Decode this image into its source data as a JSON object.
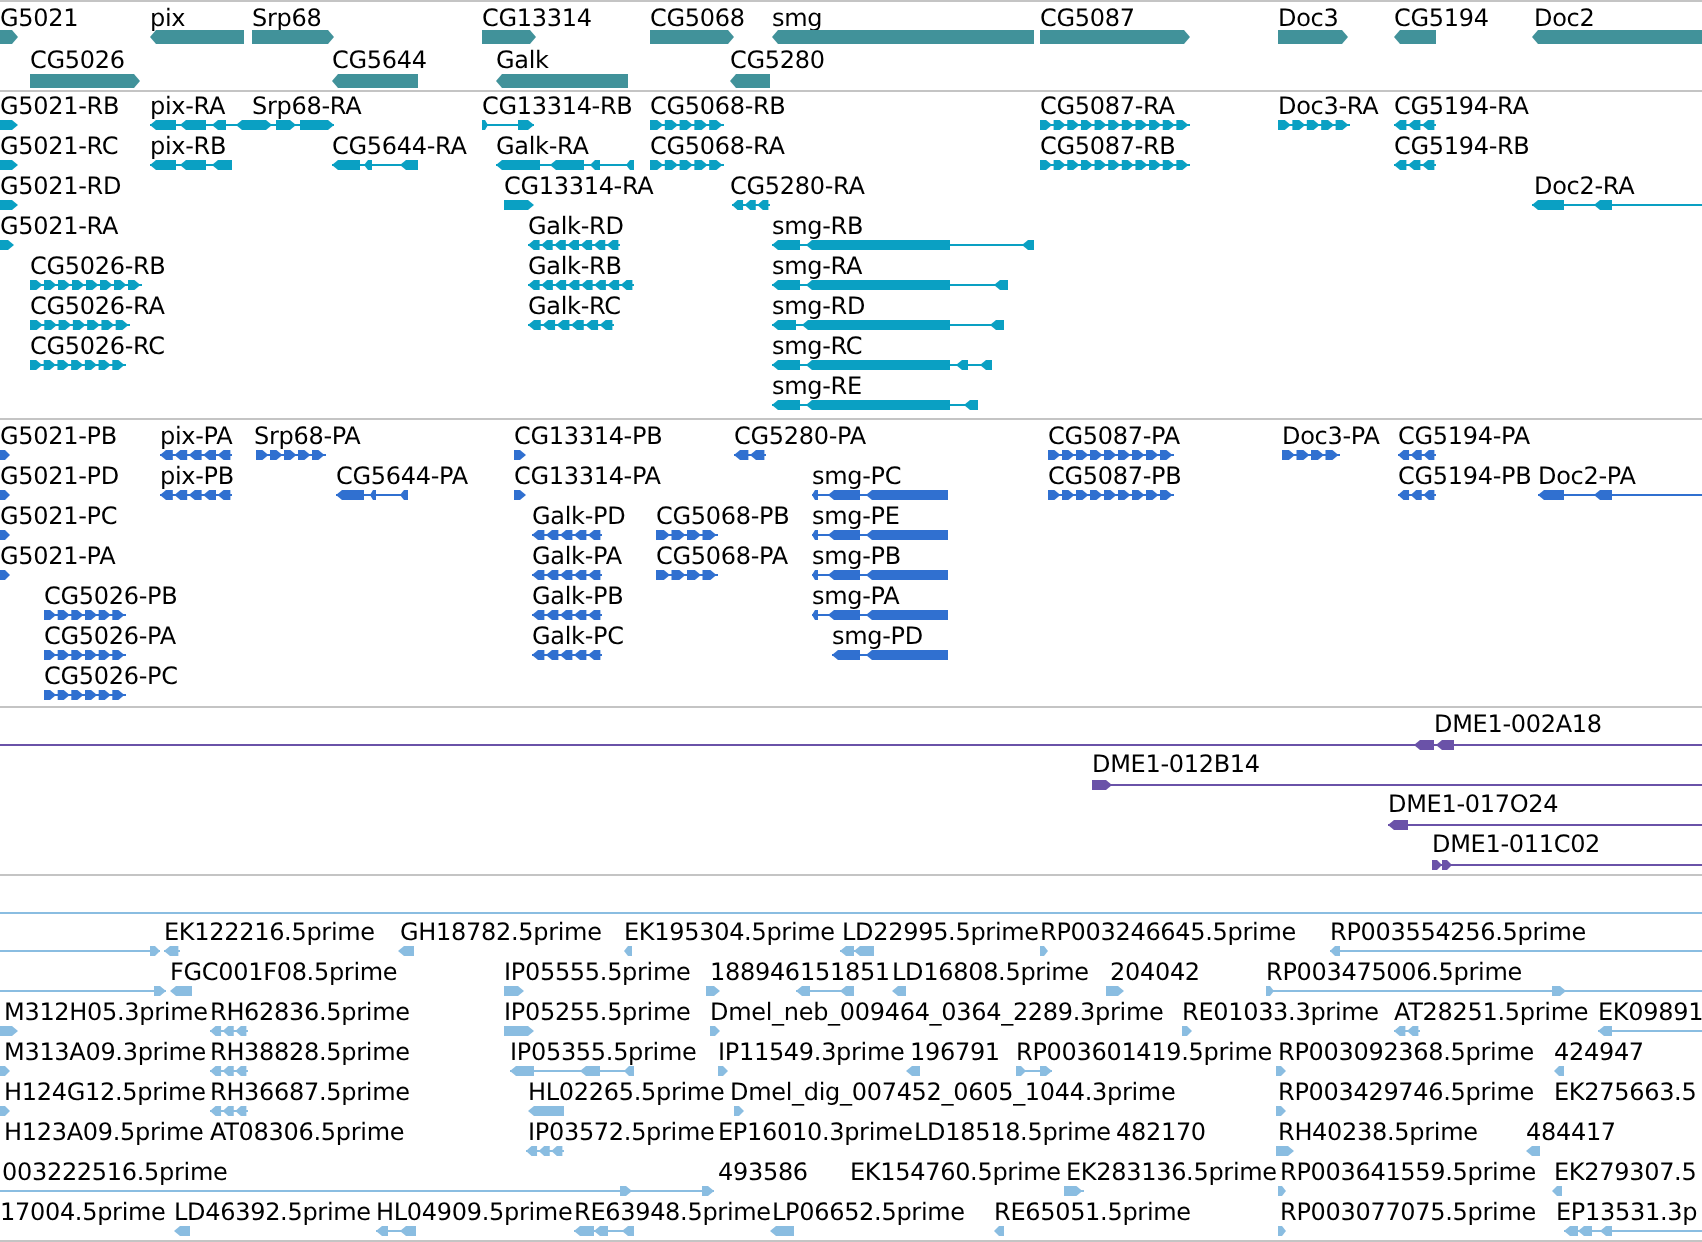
{
  "tracks": [
    {
      "kind": "genes",
      "color": "#41929a",
      "lanes": [
        {
          "features": [
            {
              "label": "G5021",
              "reverse": false
            },
            {
              "label": "pix",
              "reverse": true
            },
            {
              "label": "Srp68",
              "reverse": false
            },
            {
              "label": "CG13314",
              "reverse": false
            },
            {
              "label": "CG5068",
              "reverse": false
            },
            {
              "label": "smg",
              "reverse": true
            },
            {
              "label": "CG5087",
              "reverse": false
            },
            {
              "label": "Doc3",
              "reverse": false
            },
            {
              "label": "CG5194",
              "reverse": true
            },
            {
              "label": "Doc2",
              "reverse": true
            }
          ]
        },
        {
          "features": [
            {
              "label": "CG5026",
              "reverse": false
            },
            {
              "label": "CG5644",
              "reverse": true
            },
            {
              "label": "Galk",
              "reverse": true
            },
            {
              "label": "CG5280",
              "reverse": true
            }
          ]
        }
      ]
    },
    {
      "kind": "transcripts",
      "color": "#0aa0c3",
      "lanes": [
        {
          "features": [
            {
              "label": "G5021-RB",
              "reverse": false
            },
            {
              "label": "pix-RA",
              "reverse": true
            },
            {
              "label": "Srp68-RA",
              "reverse": false
            },
            {
              "label": "CG13314-RB",
              "reverse": false
            },
            {
              "label": "CG5068-RB",
              "reverse": false
            },
            {
              "label": "CG5087-RA",
              "reverse": false
            },
            {
              "label": "Doc3-RA",
              "reverse": false
            },
            {
              "label": "CG5194-RA",
              "reverse": true
            }
          ]
        },
        {
          "features": [
            {
              "label": "G5021-RC",
              "reverse": false
            },
            {
              "label": "pix-RB",
              "reverse": true
            },
            {
              "label": "CG5644-RA",
              "reverse": true
            },
            {
              "label": "Galk-RA",
              "reverse": true
            },
            {
              "label": "CG5068-RA",
              "reverse": false
            },
            {
              "label": "CG5087-RB",
              "reverse": false
            },
            {
              "label": "CG5194-RB",
              "reverse": true
            }
          ]
        },
        {
          "features": [
            {
              "label": "G5021-RD",
              "reverse": false
            },
            {
              "label": "CG13314-RA",
              "reverse": false
            },
            {
              "label": "CG5280-RA",
              "reverse": true
            },
            {
              "label": "Doc2-RA",
              "reverse": true
            }
          ]
        },
        {
          "features": [
            {
              "label": "G5021-RA",
              "reverse": false
            },
            {
              "label": "Galk-RD",
              "reverse": true
            },
            {
              "label": "smg-RB",
              "reverse": true
            }
          ]
        },
        {
          "features": [
            {
              "label": "CG5026-RB",
              "reverse": false
            },
            {
              "label": "Galk-RB",
              "reverse": true
            },
            {
              "label": "smg-RA",
              "reverse": true
            }
          ]
        },
        {
          "features": [
            {
              "label": "CG5026-RA",
              "reverse": false
            },
            {
              "label": "Galk-RC",
              "reverse": true
            },
            {
              "label": "smg-RD",
              "reverse": true
            }
          ]
        },
        {
          "features": [
            {
              "label": "CG5026-RC",
              "reverse": false
            },
            {
              "label": "smg-RC",
              "reverse": true
            }
          ]
        },
        {
          "features": [
            {
              "label": "smg-RE",
              "reverse": true
            }
          ]
        }
      ]
    },
    {
      "kind": "proteins",
      "color": "#3070d0",
      "lanes": [
        {
          "features": [
            {
              "label": "G5021-PB",
              "reverse": false
            },
            {
              "label": "pix-PA",
              "reverse": true
            },
            {
              "label": "Srp68-PA",
              "reverse": false
            },
            {
              "label": "CG13314-PB",
              "reverse": false
            },
            {
              "label": "CG5280-PA",
              "reverse": true
            },
            {
              "label": "CG5087-PA",
              "reverse": false
            },
            {
              "label": "Doc3-PA",
              "reverse": false
            },
            {
              "label": "CG5194-PA",
              "reverse": true
            }
          ]
        },
        {
          "features": [
            {
              "label": "G5021-PD",
              "reverse": false
            },
            {
              "label": "pix-PB",
              "reverse": true
            },
            {
              "label": "CG5644-PA",
              "reverse": true
            },
            {
              "label": "CG13314-PA",
              "reverse": false
            },
            {
              "label": "smg-PC",
              "reverse": true
            },
            {
              "label": "CG5087-PB",
              "reverse": false
            },
            {
              "label": "CG5194-PB",
              "reverse": true
            },
            {
              "label": "Doc2-PA",
              "reverse": true
            }
          ]
        },
        {
          "features": [
            {
              "label": "G5021-PC",
              "reverse": false
            },
            {
              "label": "Galk-PD",
              "reverse": true
            },
            {
              "label": "CG5068-PB",
              "reverse": false
            },
            {
              "label": "smg-PE",
              "reverse": true
            }
          ]
        },
        {
          "features": [
            {
              "label": "G5021-PA",
              "reverse": false
            },
            {
              "label": "Galk-PA",
              "reverse": true
            },
            {
              "label": "CG5068-PA",
              "reverse": false
            },
            {
              "label": "smg-PB",
              "reverse": true
            }
          ]
        },
        {
          "features": [
            {
              "label": "CG5026-PB",
              "reverse": false
            },
            {
              "label": "Galk-PB",
              "reverse": true
            },
            {
              "label": "smg-PA",
              "reverse": true
            }
          ]
        },
        {
          "features": [
            {
              "label": "CG5026-PA",
              "reverse": false
            },
            {
              "label": "Galk-PC",
              "reverse": true
            },
            {
              "label": "smg-PD",
              "reverse": true
            }
          ]
        },
        {
          "features": [
            {
              "label": "CG5026-PC",
              "reverse": false
            }
          ]
        }
      ]
    },
    {
      "kind": "clones",
      "color": "#6a52a8",
      "lanes": [
        {
          "features": [
            {
              "label": "DME1-002A18",
              "reverse": true
            }
          ]
        },
        {
          "features": [
            {
              "label": "DME1-012B14",
              "reverse": false
            }
          ]
        },
        {
          "features": [
            {
              "label": "DME1-017O24",
              "reverse": true
            }
          ]
        },
        {
          "features": [
            {
              "label": "DME1-011C02",
              "reverse": false
            }
          ]
        }
      ]
    },
    {
      "kind": "ests",
      "color": "#8abde1",
      "lanes": [
        {
          "features": [
            {
              "reverse": false
            },
            {
              "label": "EK122216.5prime",
              "reverse": true
            },
            {
              "label": "GH18782.5prime",
              "reverse": true
            },
            {
              "label": "EK195304.5prime",
              "reverse": true
            },
            {
              "label": "LD22995.5prime",
              "reverse": true
            },
            {
              "label": "RP003246645.5prime",
              "reverse": false
            },
            {
              "label": "RP003554256.5prime",
              "reverse": true
            }
          ]
        },
        {
          "features": [
            {
              "reverse": false
            },
            {
              "label": "FGC001F08.5prime",
              "reverse": true
            },
            {
              "label": "IP05555.5prime",
              "reverse": false
            },
            {
              "label": "188946",
              "reverse": false
            },
            {
              "label": "151851",
              "reverse": true
            },
            {
              "label": "LD16808.5prime",
              "reverse": true
            },
            {
              "label": "204042",
              "reverse": false
            },
            {
              "label": "RP003475006.5prime",
              "reverse": false
            }
          ]
        },
        {
          "features": [
            {
              "label": "M312H05.3prime",
              "reverse": false
            },
            {
              "label": "RH62836.5prime",
              "reverse": true
            },
            {
              "label": "IP05255.5prime",
              "reverse": false
            },
            {
              "label": "Dmel_neb_009464_0364_2289.3prime",
              "reverse": false
            },
            {
              "label": "RE01033.3prime",
              "reverse": false
            },
            {
              "label": "AT28251.5prime",
              "reverse": true
            },
            {
              "label": "EK09891",
              "reverse": true
            }
          ]
        },
        {
          "features": [
            {
              "label": "M313A09.3prime",
              "reverse": false
            },
            {
              "label": "RH38828.5prime",
              "reverse": true
            },
            {
              "label": "IP05355.5prime",
              "reverse": true
            },
            {
              "label": "IP11549.3prime",
              "reverse": false
            },
            {
              "label": "196791",
              "reverse": true
            },
            {
              "label": "RP003601419.5prime",
              "reverse": false
            },
            {
              "label": "RP003092368.5prime",
              "reverse": false
            },
            {
              "label": "424947",
              "reverse": true
            }
          ]
        },
        {
          "features": [
            {
              "label": "H124G12.5prime",
              "reverse": false
            },
            {
              "label": "RH36687.5prime",
              "reverse": true
            },
            {
              "label": "HL02265.5prime",
              "reverse": true
            },
            {
              "label": "Dmel_dig_007452_0605_1044.3prime",
              "reverse": false
            },
            {
              "label": "RP003429746.5prime",
              "reverse": false
            },
            {
              "label": "EK275663.5"
            }
          ]
        },
        {
          "features": [
            {
              "label": "H123A09.5prime"
            },
            {
              "label": "AT08306.5prime"
            },
            {
              "label": "IP03572.5prime",
              "reverse": true
            },
            {
              "label": "EP16010.3prime"
            },
            {
              "label": "LD18518.5prime"
            },
            {
              "label": "482170"
            },
            {
              "label": "RH40238.5prime",
              "reverse": false
            },
            {
              "label": "484417",
              "reverse": true
            }
          ]
        },
        {
          "features": [
            {
              "label": "003222516.5prime",
              "reverse": false
            },
            {
              "label": "493586"
            },
            {
              "label": "EK154760.5prime"
            },
            {
              "label": "EK283136.5prime",
              "reverse": false
            },
            {
              "label": "RP003641559.5prime",
              "reverse": false
            },
            {
              "label": "EK279307.5",
              "reverse": true
            }
          ]
        },
        {
          "features": [
            {
              "label": "17004.5prime"
            },
            {
              "label": "LD46392.5prime",
              "reverse": true
            },
            {
              "label": "HL04909.5prime",
              "reverse": true
            },
            {
              "label": "RE63948.5prime",
              "reverse": true
            },
            {
              "label": "LP06652.5prime",
              "reverse": true
            },
            {
              "label": "RE65051.5prime",
              "reverse": true
            },
            {
              "label": "RP003077075.5prime",
              "reverse": false
            },
            {
              "label": "EP13531.3p",
              "reverse": true
            }
          ]
        }
      ]
    }
  ]
}
